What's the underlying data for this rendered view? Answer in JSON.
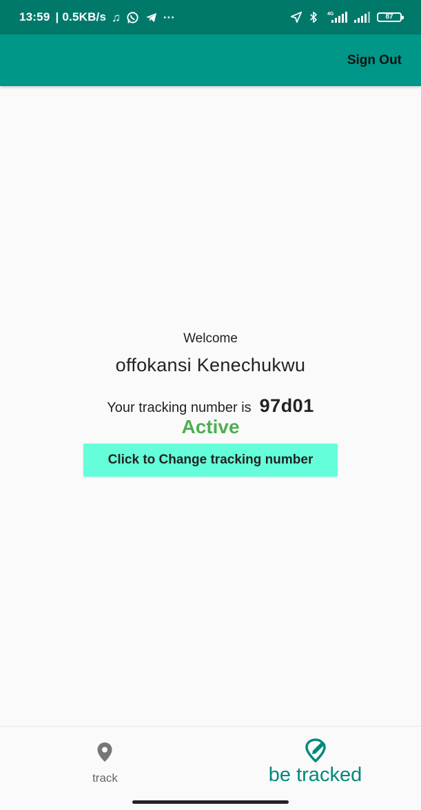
{
  "status_bar": {
    "time": "13:59",
    "net_speed": "| 0.5KB/s",
    "music_icon": "music-note",
    "more_dots": "···",
    "network_type": "4G",
    "battery_level": "87"
  },
  "app_bar": {
    "sign_out_label": "Sign Out"
  },
  "main": {
    "welcome_label": "Welcome",
    "user_name": "offokansi Kenechukwu",
    "tracking_label": "Your tracking number is",
    "tracking_number": "97d01",
    "status_text": "Active",
    "change_button_label": "Click to Change tracking number"
  },
  "bottom_nav": {
    "items": [
      {
        "label": "track",
        "icon": "location-pin-icon",
        "selected": false
      },
      {
        "label": "be tracked",
        "icon": "location-edit-icon",
        "selected": true
      }
    ]
  },
  "colors": {
    "status_bar": "#00796b",
    "app_bar": "#009688",
    "accent_button": "#64ffda",
    "active_status": "#4caf50",
    "nav_selected": "#00897b",
    "nav_unselected": "#666666"
  }
}
